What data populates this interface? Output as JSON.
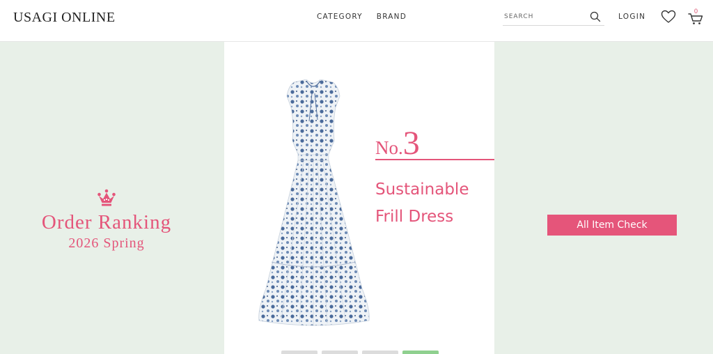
{
  "header": {
    "logo": "USAGI ONLINE",
    "nav": [
      "CATEGORY",
      "BRAND"
    ],
    "search_placeholder": "SEARCH",
    "login": "LOGIN",
    "cart_count": "0"
  },
  "hero": {
    "ranking_title": "Order Ranking",
    "ranking_season": "2026 Spring",
    "rank_prefix": "No.",
    "rank_number": "3",
    "product_name_line1": "Sustainable",
    "product_name_line2": "Frill Dress",
    "cta_label": "All Item Check",
    "thumbnail_count": 4,
    "active_thumbnail": 4
  },
  "colors": {
    "accent": "#e4557a",
    "hero_bg": "#e8f0e8",
    "active_indicator": "#8fd08f"
  },
  "icons": [
    "search-icon",
    "heart-icon",
    "cart-icon",
    "crown-icon"
  ]
}
